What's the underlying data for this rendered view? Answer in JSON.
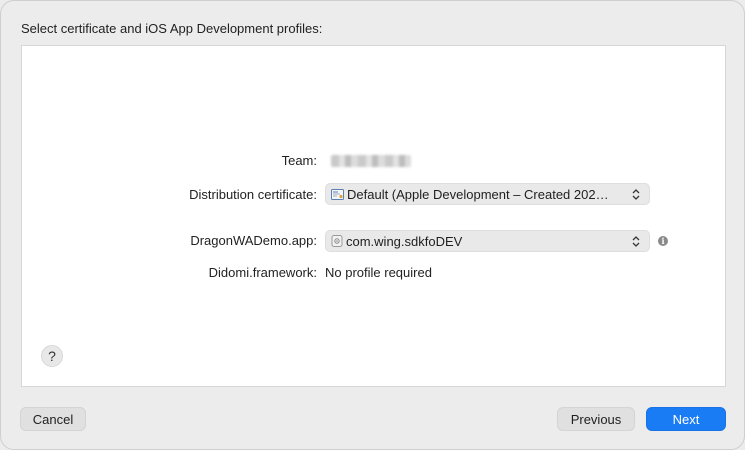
{
  "heading": "Select certificate and iOS App Development profiles:",
  "rows": {
    "team": {
      "label": "Team:"
    },
    "distribution_certificate": {
      "label": "Distribution certificate:",
      "value": "Default (Apple Development – Created 202…",
      "icon": "certificate-icon"
    },
    "app": {
      "label": "DragonWADemo.app:",
      "value": "com.wing.sdkfoDEV",
      "icon": "provisioning-profile-icon",
      "info_icon": "info-icon"
    },
    "framework": {
      "label": "Didomi.framework:",
      "value": "No profile required"
    }
  },
  "help": {
    "symbol": "?"
  },
  "buttons": {
    "cancel": "Cancel",
    "previous": "Previous",
    "next": "Next"
  },
  "colors": {
    "accent": "#1a7cf5",
    "window_bg": "#ececec",
    "panel_bg": "#ffffff"
  }
}
